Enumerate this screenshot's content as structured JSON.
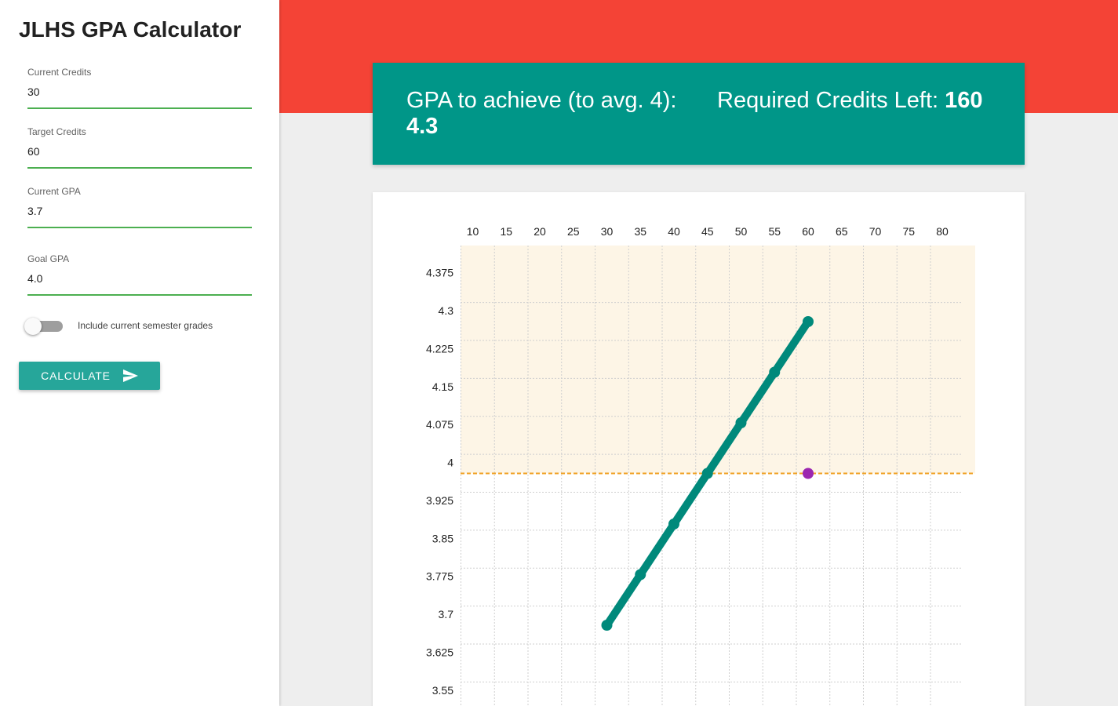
{
  "app": {
    "title": "JLHS GPA Calculator"
  },
  "form": {
    "current_credits": {
      "label": "Current Credits",
      "value": "30"
    },
    "target_credits": {
      "label": "Target Credits",
      "value": "60"
    },
    "current_gpa": {
      "label": "Current GPA",
      "value": "3.7"
    },
    "goal_gpa": {
      "label": "Goal GPA",
      "value": "4.0"
    },
    "toggle": {
      "label": "Include current semester grades",
      "checked": false
    },
    "calculate_label": "CALCULATE"
  },
  "results": {
    "gpa_label": "GPA to achieve (to avg. 4):",
    "gpa_value": "4.3",
    "credits_label": "Required Credits Left:",
    "credits_value": "160"
  },
  "colors": {
    "banner": "#f44336",
    "card": "#009688",
    "button": "#26a69a",
    "input_underline": "#4caf50",
    "line": "#00897b",
    "goal_line": "#f0a020",
    "goal_point": "#9c27b0",
    "highlight_region": "#fdf5e6"
  },
  "chart_data": {
    "type": "line",
    "title": "",
    "xlabel": "",
    "ylabel": "",
    "x_ticks": [
      10,
      15,
      20,
      25,
      30,
      35,
      40,
      45,
      50,
      55,
      60,
      65,
      70,
      75,
      80
    ],
    "y_ticks": [
      3.55,
      3.625,
      3.7,
      3.775,
      3.85,
      3.925,
      4,
      4.075,
      4.15,
      4.225,
      4.3,
      4.375
    ],
    "y_tick_labels": [
      "3.55",
      "3.625",
      "3.7",
      "3.775",
      "3.85",
      "3.925",
      "4",
      "4.075",
      "4.15",
      "4.225",
      "4.3",
      "4.375"
    ],
    "xlim": [
      10,
      80
    ],
    "ylim": [
      3.55,
      4.4
    ],
    "series": [
      {
        "x": [
          30,
          35,
          40,
          45,
          50,
          55,
          60
        ],
        "y": [
          3.7,
          3.8,
          3.9,
          4.0,
          4.1,
          4.2,
          4.3
        ]
      }
    ],
    "goal_line": {
      "y": 4.0
    },
    "goal_point": {
      "x": 60,
      "y": 4.0
    },
    "grid": true
  }
}
